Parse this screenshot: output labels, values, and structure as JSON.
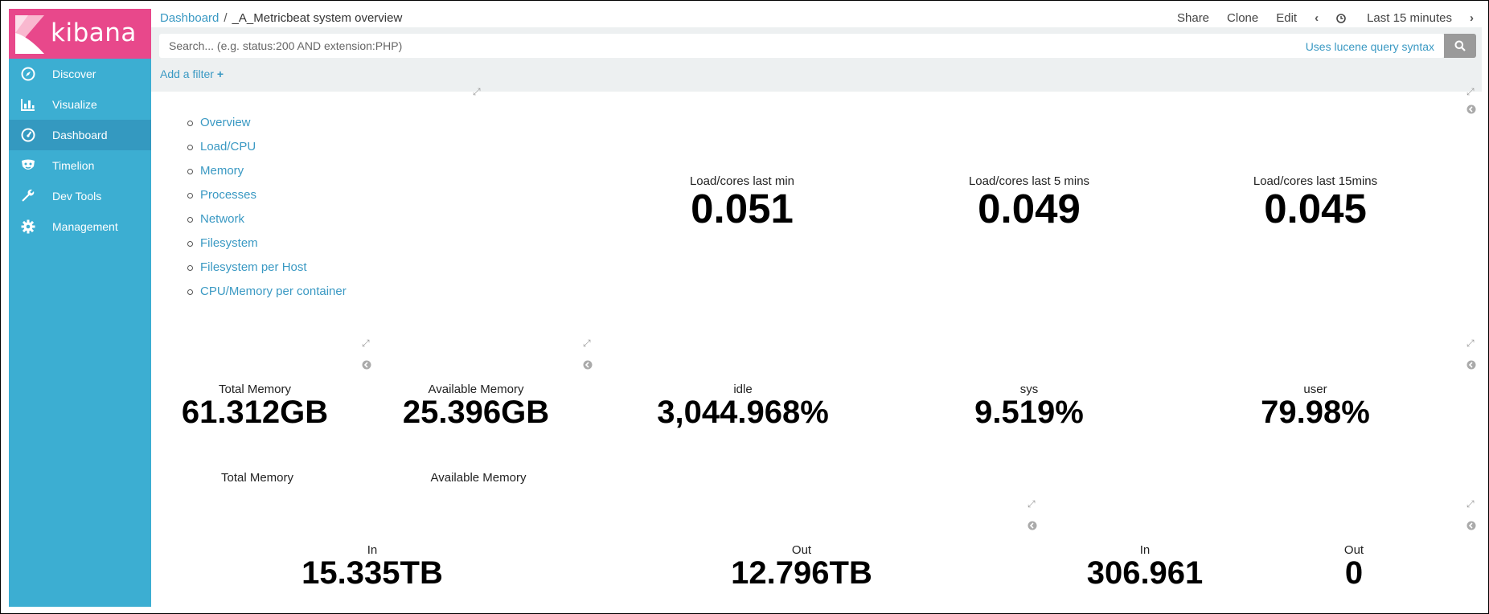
{
  "app": {
    "logo_text": "kibana",
    "brand_color": "#e8488b",
    "sidebar_color": "#3caed2",
    "link_color": "#3a99c3"
  },
  "sidebar": {
    "items": [
      {
        "label": "Discover",
        "icon": "compass-icon"
      },
      {
        "label": "Visualize",
        "icon": "bar-chart-icon"
      },
      {
        "label": "Dashboard",
        "icon": "dashboard-gauge-icon"
      },
      {
        "label": "Timelion",
        "icon": "timelion-mask-icon"
      },
      {
        "label": "Dev Tools",
        "icon": "wrench-icon"
      },
      {
        "label": "Management",
        "icon": "gear-icon"
      }
    ],
    "active": "Dashboard"
  },
  "header": {
    "breadcrumb_root": "Dashboard",
    "breadcrumb_sep": "/",
    "title": "_A_Metricbeat system overview",
    "share": "Share",
    "clone": "Clone",
    "edit": "Edit",
    "prev": "‹",
    "time_range": "Last 15 minutes",
    "next": "›"
  },
  "search": {
    "placeholder": "Search... (e.g. status:200 AND extension:PHP)",
    "lucene_link": "Uses lucene query syntax",
    "add_filter": "Add a filter"
  },
  "navigation_links": [
    "Overview",
    "Load/CPU",
    "Memory",
    "Processes",
    "Network",
    "Filesystem",
    "Filesystem per Host",
    "CPU/Memory per container"
  ],
  "load": {
    "load1": {
      "label": "Load/cores last min",
      "value": "0.051"
    },
    "load5": {
      "label": "Load/cores last 5 mins",
      "value": "0.049"
    },
    "load15": {
      "label": "Load/cores last 15mins",
      "value": "0.045"
    }
  },
  "memory": {
    "total": {
      "label": "Total Memory",
      "value": "61.312GB",
      "caption": "Total Memory"
    },
    "available": {
      "label": "Available Memory",
      "value": "25.396GB",
      "caption": "Available Memory"
    }
  },
  "cpu": {
    "idle": {
      "label": "idle",
      "value": "3,044.968%"
    },
    "sys": {
      "label": "sys",
      "value": "9.519%"
    },
    "user": {
      "label": "user",
      "value": "79.98%"
    }
  },
  "network": {
    "bytes_in": {
      "label": "In",
      "value": "15.335TB"
    },
    "bytes_out": {
      "label": "Out",
      "value": "12.796TB"
    },
    "packets_in": {
      "label": "In",
      "value": "306.961"
    },
    "packets_out": {
      "label": "Out",
      "value": "0"
    }
  }
}
